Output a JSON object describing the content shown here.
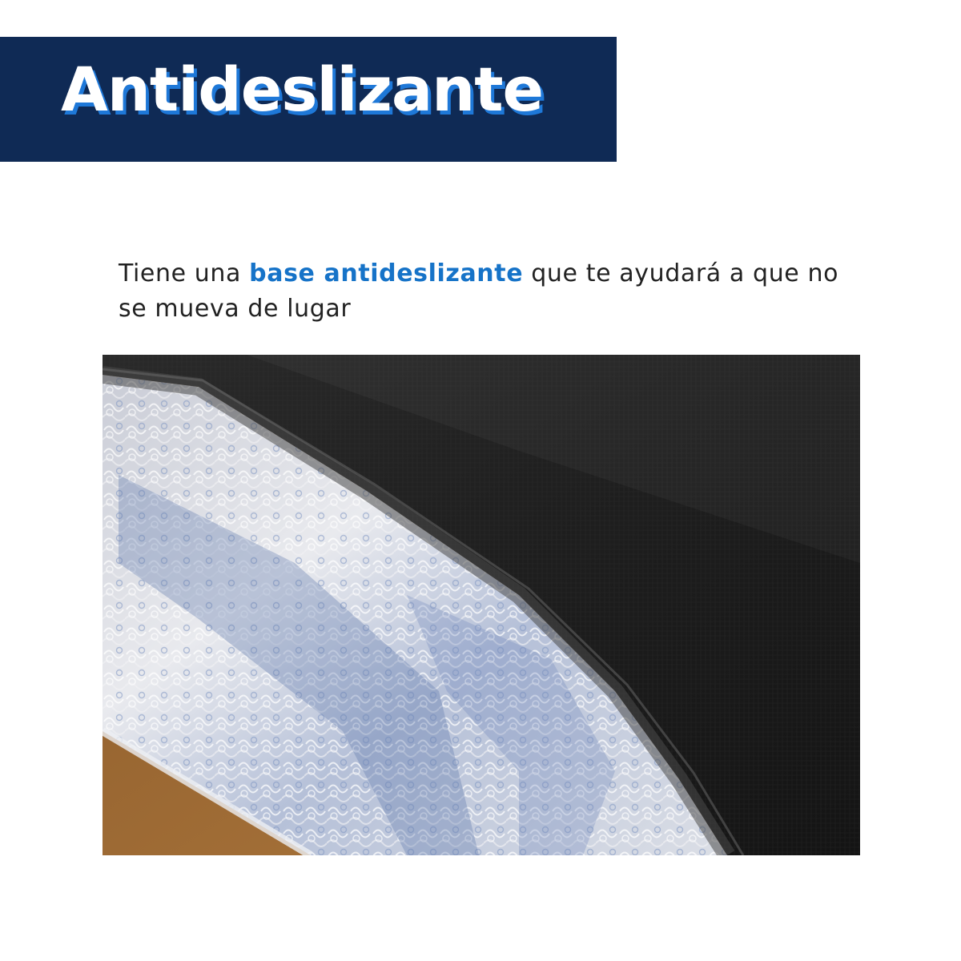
{
  "title": "Antideslizante",
  "description": {
    "text_before": "Tiene una ",
    "highlight": "base antideslizante",
    "text_after": " que te ayudará a que no se mueva de lugar"
  },
  "photo": {
    "subject": "close-up of mat with black anti-slip backing over white and blue coil fibers on wooden floor"
  },
  "colors": {
    "banner": "#0f2a55",
    "title_shadow": "#1e78d8",
    "highlight": "#1673c8",
    "text": "#222222"
  }
}
